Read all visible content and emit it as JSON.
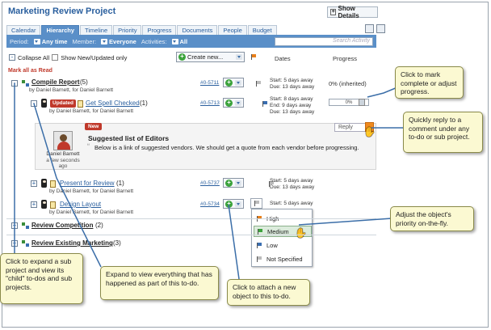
{
  "header": {
    "title": "Marketing Review Project",
    "show_details": "Show Details"
  },
  "tabs": [
    "Calendar",
    "Hierarchy",
    "Timeline",
    "Priority",
    "Progress",
    "Documents",
    "People",
    "Budget"
  ],
  "filter": {
    "period_label": "Period:",
    "period_value": "Any time",
    "member_label": "Member:",
    "member_value": "Everyone",
    "activities_label": "Activities:",
    "activities_value": "All",
    "search_placeholder": "Search Activity"
  },
  "toolbar": {
    "collapse_all": "Collapse All",
    "show_new": "Show New/Updated only",
    "create_new": "Create new...",
    "dates_header": "Dates",
    "progress_header": "Progress"
  },
  "mark_all_read": "Mark all as Read",
  "items": {
    "compile": {
      "name": "Compile Report",
      "count": "(5)",
      "by": "by Daniel Barnett, for Daniel Barnett",
      "id": "#0-5711",
      "start": "Start: 5 days away",
      "due": "Due: 13 days away",
      "progress": "0% (inherited)"
    },
    "spell": {
      "badge": "Updated",
      "name": "Get Spell Checked",
      "count": "(1)",
      "by": "by Daniel Barnett, for Daniel Barnett",
      "id": "#0-5713",
      "start": "Start: 8 days away",
      "end": "End: 9 days away",
      "due": "Due: 13 days away",
      "progress": "0%"
    },
    "present": {
      "name": "Present for Review",
      "count": "(1)",
      "by": "by Daniel Barnett, for Daniel Barnett",
      "id": "#0-5737",
      "start": "Start: 5 days away",
      "due": "Due: 13 days away"
    },
    "design": {
      "name": "Design Layout",
      "by": "by Daniel Barnett, for Daniel Barnett",
      "id": "#0-5734",
      "start": "Start: 5 days away"
    },
    "competition": {
      "name": "Review Competition",
      "count": "(2)"
    },
    "marketing": {
      "name": "Review Existing Marketing",
      "count": "(3)"
    }
  },
  "comment": {
    "badge": "New",
    "author": "Daniel Barnett",
    "time": "a few seconds ago",
    "subject": "Suggested list of Editors",
    "body": "Below is a link of suggested vendors.  We should get a quote from each vendor before progressing.",
    "reply": "Reply"
  },
  "priority_menu": [
    "High",
    "Medium",
    "Low",
    "Not Specified"
  ],
  "callouts": {
    "progress": "Click to mark complete or adjust progress.",
    "reply": "Quickly reply to a comment under any to-do or sub project.",
    "priority": "Adjust the object's priority on-the-fly.",
    "expand_sub": "Click to expand a sub project and view its \"child\" to-dos and sub projects.",
    "expand_todo": "Expand to view everything that has happened as part of this to-do.",
    "attach": "Click to attach a new object to this to-do."
  },
  "colors": {
    "accent": "#5a8fc8",
    "link": "#2a5f9e",
    "callout_bg": "#fbf9d2",
    "badge_red": "#c0392b",
    "flag_high": "#e8801c",
    "flag_medium": "#3ca33c",
    "flag_low": "#3a6eb0",
    "flag_none": "#bbbbbb"
  }
}
